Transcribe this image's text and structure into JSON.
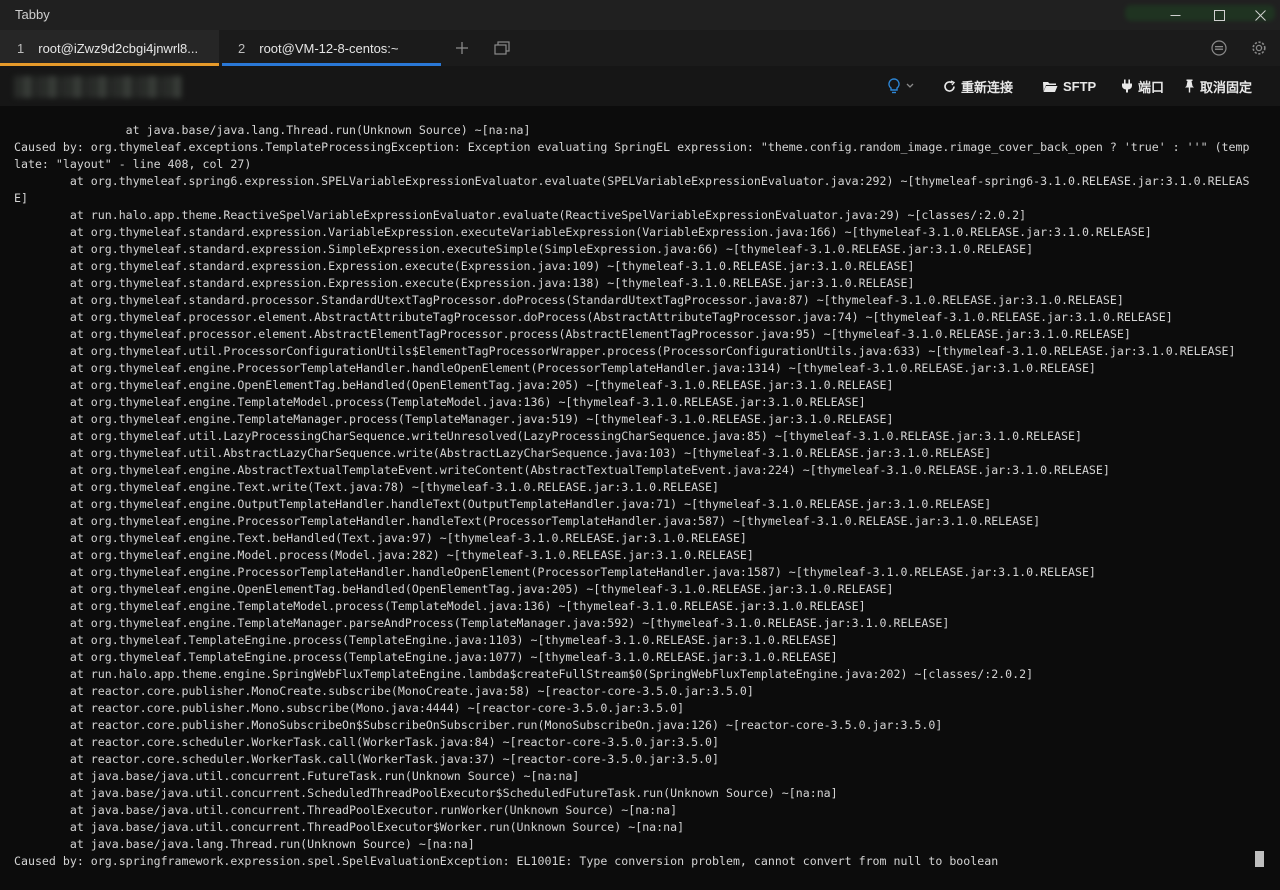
{
  "app": {
    "title": "Tabby"
  },
  "window_controls": {
    "minimize": "—",
    "maximize": "☐",
    "close": "✕"
  },
  "tabs": [
    {
      "number": "1",
      "title": "root@iZwz9d2cbgi4jnwrl8..."
    },
    {
      "number": "2",
      "title": "root@VM-12-8-centos:~"
    }
  ],
  "toolbar": {
    "reconnect": "重新连接",
    "sftp": "SFTP",
    "ports": "端口",
    "unpin": "取消固定"
  },
  "colors": {
    "tab1_accent": "#e69a2a",
    "tab2_accent": "#2a78d6",
    "terminal_bg": "#0c0c0c",
    "bulb_icon": "#2d86d6"
  },
  "terminal": {
    "lines": [
      "                at java.base/java.lang.Thread.run(Unknown Source) ~[na:na]",
      "Caused by: org.thymeleaf.exceptions.TemplateProcessingException: Exception evaluating SpringEL expression: \"theme.config.random_image.rimage_cover_back_open ? 'true' : ''\" (temp",
      "late: \"layout\" - line 408, col 27)",
      "        at org.thymeleaf.spring6.expression.SPELVariableExpressionEvaluator.evaluate(SPELVariableExpressionEvaluator.java:292) ~[thymeleaf-spring6-3.1.0.RELEASE.jar:3.1.0.RELEAS",
      "E]",
      "        at run.halo.app.theme.ReactiveSpelVariableExpressionEvaluator.evaluate(ReactiveSpelVariableExpressionEvaluator.java:29) ~[classes/:2.0.2]",
      "        at org.thymeleaf.standard.expression.VariableExpression.executeVariableExpression(VariableExpression.java:166) ~[thymeleaf-3.1.0.RELEASE.jar:3.1.0.RELEASE]",
      "        at org.thymeleaf.standard.expression.SimpleExpression.executeSimple(SimpleExpression.java:66) ~[thymeleaf-3.1.0.RELEASE.jar:3.1.0.RELEASE]",
      "        at org.thymeleaf.standard.expression.Expression.execute(Expression.java:109) ~[thymeleaf-3.1.0.RELEASE.jar:3.1.0.RELEASE]",
      "        at org.thymeleaf.standard.expression.Expression.execute(Expression.java:138) ~[thymeleaf-3.1.0.RELEASE.jar:3.1.0.RELEASE]",
      "        at org.thymeleaf.standard.processor.StandardUtextTagProcessor.doProcess(StandardUtextTagProcessor.java:87) ~[thymeleaf-3.1.0.RELEASE.jar:3.1.0.RELEASE]",
      "        at org.thymeleaf.processor.element.AbstractAttributeTagProcessor.doProcess(AbstractAttributeTagProcessor.java:74) ~[thymeleaf-3.1.0.RELEASE.jar:3.1.0.RELEASE]",
      "        at org.thymeleaf.processor.element.AbstractElementTagProcessor.process(AbstractElementTagProcessor.java:95) ~[thymeleaf-3.1.0.RELEASE.jar:3.1.0.RELEASE]",
      "        at org.thymeleaf.util.ProcessorConfigurationUtils$ElementTagProcessorWrapper.process(ProcessorConfigurationUtils.java:633) ~[thymeleaf-3.1.0.RELEASE.jar:3.1.0.RELEASE]",
      "        at org.thymeleaf.engine.ProcessorTemplateHandler.handleOpenElement(ProcessorTemplateHandler.java:1314) ~[thymeleaf-3.1.0.RELEASE.jar:3.1.0.RELEASE]",
      "        at org.thymeleaf.engine.OpenElementTag.beHandled(OpenElementTag.java:205) ~[thymeleaf-3.1.0.RELEASE.jar:3.1.0.RELEASE]",
      "        at org.thymeleaf.engine.TemplateModel.process(TemplateModel.java:136) ~[thymeleaf-3.1.0.RELEASE.jar:3.1.0.RELEASE]",
      "        at org.thymeleaf.engine.TemplateManager.process(TemplateManager.java:519) ~[thymeleaf-3.1.0.RELEASE.jar:3.1.0.RELEASE]",
      "        at org.thymeleaf.util.LazyProcessingCharSequence.writeUnresolved(LazyProcessingCharSequence.java:85) ~[thymeleaf-3.1.0.RELEASE.jar:3.1.0.RELEASE]",
      "        at org.thymeleaf.util.AbstractLazyCharSequence.write(AbstractLazyCharSequence.java:103) ~[thymeleaf-3.1.0.RELEASE.jar:3.1.0.RELEASE]",
      "        at org.thymeleaf.engine.AbstractTextualTemplateEvent.writeContent(AbstractTextualTemplateEvent.java:224) ~[thymeleaf-3.1.0.RELEASE.jar:3.1.0.RELEASE]",
      "        at org.thymeleaf.engine.Text.write(Text.java:78) ~[thymeleaf-3.1.0.RELEASE.jar:3.1.0.RELEASE]",
      "        at org.thymeleaf.engine.OutputTemplateHandler.handleText(OutputTemplateHandler.java:71) ~[thymeleaf-3.1.0.RELEASE.jar:3.1.0.RELEASE]",
      "        at org.thymeleaf.engine.ProcessorTemplateHandler.handleText(ProcessorTemplateHandler.java:587) ~[thymeleaf-3.1.0.RELEASE.jar:3.1.0.RELEASE]",
      "        at org.thymeleaf.engine.Text.beHandled(Text.java:97) ~[thymeleaf-3.1.0.RELEASE.jar:3.1.0.RELEASE]",
      "        at org.thymeleaf.engine.Model.process(Model.java:282) ~[thymeleaf-3.1.0.RELEASE.jar:3.1.0.RELEASE]",
      "        at org.thymeleaf.engine.ProcessorTemplateHandler.handleOpenElement(ProcessorTemplateHandler.java:1587) ~[thymeleaf-3.1.0.RELEASE.jar:3.1.0.RELEASE]",
      "        at org.thymeleaf.engine.OpenElementTag.beHandled(OpenElementTag.java:205) ~[thymeleaf-3.1.0.RELEASE.jar:3.1.0.RELEASE]",
      "        at org.thymeleaf.engine.TemplateModel.process(TemplateModel.java:136) ~[thymeleaf-3.1.0.RELEASE.jar:3.1.0.RELEASE]",
      "        at org.thymeleaf.engine.TemplateManager.parseAndProcess(TemplateManager.java:592) ~[thymeleaf-3.1.0.RELEASE.jar:3.1.0.RELEASE]",
      "        at org.thymeleaf.TemplateEngine.process(TemplateEngine.java:1103) ~[thymeleaf-3.1.0.RELEASE.jar:3.1.0.RELEASE]",
      "        at org.thymeleaf.TemplateEngine.process(TemplateEngine.java:1077) ~[thymeleaf-3.1.0.RELEASE.jar:3.1.0.RELEASE]",
      "        at run.halo.app.theme.engine.SpringWebFluxTemplateEngine.lambda$createFullStream$0(SpringWebFluxTemplateEngine.java:202) ~[classes/:2.0.2]",
      "        at reactor.core.publisher.MonoCreate.subscribe(MonoCreate.java:58) ~[reactor-core-3.5.0.jar:3.5.0]",
      "        at reactor.core.publisher.Mono.subscribe(Mono.java:4444) ~[reactor-core-3.5.0.jar:3.5.0]",
      "        at reactor.core.publisher.MonoSubscribeOn$SubscribeOnSubscriber.run(MonoSubscribeOn.java:126) ~[reactor-core-3.5.0.jar:3.5.0]",
      "        at reactor.core.scheduler.WorkerTask.call(WorkerTask.java:84) ~[reactor-core-3.5.0.jar:3.5.0]",
      "        at reactor.core.scheduler.WorkerTask.call(WorkerTask.java:37) ~[reactor-core-3.5.0.jar:3.5.0]",
      "        at java.base/java.util.concurrent.FutureTask.run(Unknown Source) ~[na:na]",
      "        at java.base/java.util.concurrent.ScheduledThreadPoolExecutor$ScheduledFutureTask.run(Unknown Source) ~[na:na]",
      "        at java.base/java.util.concurrent.ThreadPoolExecutor.runWorker(Unknown Source) ~[na:na]",
      "        at java.base/java.util.concurrent.ThreadPoolExecutor$Worker.run(Unknown Source) ~[na:na]",
      "        at java.base/java.lang.Thread.run(Unknown Source) ~[na:na]",
      "Caused by: org.springframework.expression.spel.SpelEvaluationException: EL1001E: Type conversion problem, cannot convert from null to boolean"
    ]
  }
}
